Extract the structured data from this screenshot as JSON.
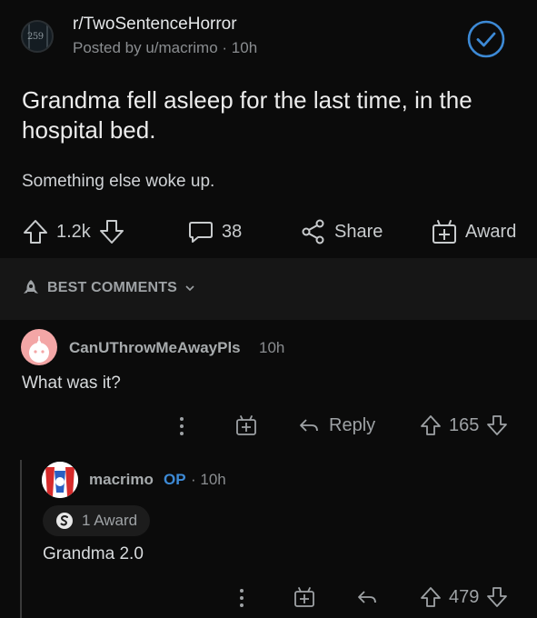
{
  "post": {
    "subreddit": "r/TwoSentenceHorror",
    "subreddit_avatar_text": "259",
    "posted_by": "Posted by u/macrimo · 10h",
    "title": "Grandma fell asleep for the last time, in the hospital bed.",
    "body": "Something else woke up.",
    "upvotes": "1.2k",
    "comments": "38",
    "share_label": "Share",
    "award_label": "Award"
  },
  "comments_section": {
    "sort_label": "BEST COMMENTS"
  },
  "comment": {
    "username": "CanUThrowMeAwayPls",
    "time": "10h",
    "text": "What was it?",
    "reply_label": "Reply",
    "votes": "165"
  },
  "reply": {
    "username": "macrimo",
    "op_badge": "OP",
    "time": "· 10h",
    "award_count": "1 Award",
    "text": "Grandma 2.0",
    "votes": "479"
  },
  "colors": {
    "background": "#0b0b0b",
    "op_blue": "#3d8ad6",
    "check_blue": "#3d8ad6"
  }
}
